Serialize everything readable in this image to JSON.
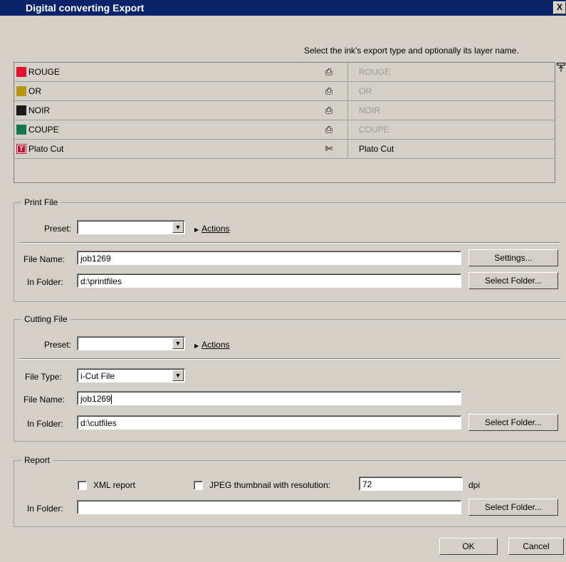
{
  "window": {
    "title": "Digital converting Export",
    "close": "X"
  },
  "hint": "Select the ink's export type and optionally its layer name.",
  "inks": [
    {
      "name": "ROUGE",
      "color": "#e8102e",
      "icon": "printer-icon",
      "glyph": "⎙",
      "layer": "ROUGE",
      "layer_enabled": false
    },
    {
      "name": "OR",
      "color": "#b8960c",
      "icon": "printer-icon",
      "glyph": "⎙",
      "layer": "OR",
      "layer_enabled": false
    },
    {
      "name": "NOIR",
      "color": "#1a1a1a",
      "icon": "printer-icon",
      "glyph": "⎙",
      "layer": "NOIR",
      "layer_enabled": false
    },
    {
      "name": "COUPE",
      "color": "#0e7a4e",
      "icon": "printer-icon",
      "glyph": "⎙",
      "layer": "COUPE",
      "layer_enabled": false
    },
    {
      "name": "Plato Cut",
      "color": "#c8102e",
      "icon": "scissors-icon",
      "glyph": "✄",
      "layer": "Plato Cut",
      "layer_enabled": true
    }
  ],
  "print_file": {
    "group_label": "Print File",
    "preset_label": "Preset:",
    "preset_value": "",
    "actions": "Actions",
    "file_name_label": "File Name:",
    "file_name": "job1269",
    "settings_button": "Settings...",
    "folder_label": "In Folder:",
    "folder": "d:\\printfiles",
    "select_folder_button": "Select Folder..."
  },
  "cutting_file": {
    "group_label": "Cutting File",
    "preset_label": "Preset:",
    "preset_value": "",
    "actions": "Actions",
    "file_type_label": "File Type:",
    "file_type": "i-Cut File",
    "file_name_label": "File Name:",
    "file_name": "job1269",
    "folder_label": "In Folder:",
    "folder": "d:\\cutfiles",
    "select_folder_button": "Select Folder..."
  },
  "report": {
    "group_label": "Report",
    "xml_label": "XML report",
    "xml_checked": false,
    "jpeg_label": "JPEG thumbnail with resolution:",
    "jpeg_checked": false,
    "resolution": "72",
    "unit": "dpi",
    "folder_label": "In Folder:",
    "folder": "",
    "select_folder_button": "Select Folder..."
  },
  "footer": {
    "ok": "OK",
    "cancel": "Cancel"
  }
}
